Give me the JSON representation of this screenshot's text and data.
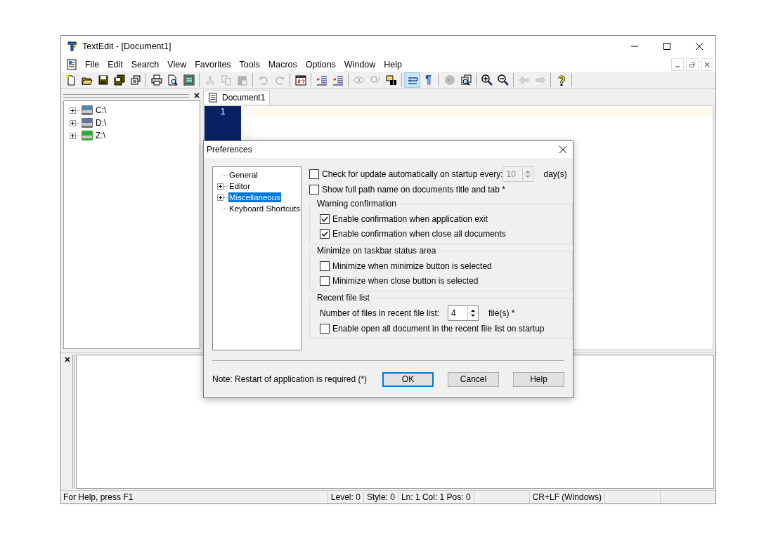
{
  "window": {
    "title": "TextEdit - [Document1]"
  },
  "menu": [
    "File",
    "Edit",
    "Search",
    "View",
    "Favorites",
    "Tools",
    "Macros",
    "Options",
    "Window",
    "Help"
  ],
  "toolbar": [
    [
      {
        "disabled": false,
        "pressed": false
      },
      {
        "disabled": false,
        "pressed": false
      },
      {
        "disabled": false,
        "pressed": false
      },
      {
        "disabled": false,
        "pressed": false
      },
      {
        "disabled": false,
        "pressed": false
      }
    ],
    [
      {
        "disabled": false,
        "pressed": false
      },
      {
        "disabled": false,
        "pressed": false
      },
      {
        "disabled": false,
        "pressed": false
      }
    ],
    [
      {
        "disabled": true,
        "pressed": false
      },
      {
        "disabled": true,
        "pressed": false
      },
      {
        "disabled": true,
        "pressed": false
      }
    ],
    [
      {
        "disabled": true,
        "pressed": false
      },
      {
        "disabled": true,
        "pressed": false
      }
    ],
    [
      {
        "disabled": false,
        "pressed": false
      }
    ],
    [
      {
        "disabled": false,
        "pressed": false
      },
      {
        "disabled": false,
        "pressed": false
      }
    ],
    [
      {
        "disabled": true,
        "pressed": false
      },
      {
        "disabled": true,
        "pressed": false
      },
      {
        "disabled": false,
        "pressed": false
      }
    ],
    [
      {
        "disabled": false,
        "pressed": true
      },
      {
        "disabled": false,
        "pressed": false,
        "label": "¶"
      }
    ],
    [
      {
        "disabled": true,
        "pressed": false
      },
      {
        "disabled": false,
        "pressed": false
      }
    ],
    [
      {
        "disabled": false,
        "pressed": false
      },
      {
        "disabled": false,
        "pressed": false
      }
    ],
    [
      {
        "disabled": true,
        "pressed": false
      },
      {
        "disabled": true,
        "pressed": false
      }
    ],
    [
      {
        "disabled": false,
        "pressed": false
      }
    ]
  ],
  "file_tree": [
    {
      "label": "C:\\",
      "expanded": false
    },
    {
      "label": "D:\\",
      "expanded": false
    },
    {
      "label": "Z:\\",
      "expanded": false
    }
  ],
  "editor": {
    "tabs": [
      {
        "label": "Document1",
        "selected": true
      }
    ],
    "line_numbers": [
      "1"
    ]
  },
  "dialog": {
    "title": "Preferences",
    "tree": [
      {
        "label": "General",
        "kind": "leaf",
        "selected": false
      },
      {
        "label": "Editor",
        "kind": "branch",
        "expanded": false,
        "selected": false
      },
      {
        "label": "Miscellaneous",
        "kind": "branch",
        "expanded": false,
        "selected": true
      },
      {
        "label": "Keyboard Shortcuts",
        "kind": "leaf",
        "selected": false
      }
    ],
    "options": [
      {
        "kind": "check_spin",
        "label": "Check for update automatically on startup every:",
        "checked": false,
        "value": "10",
        "disabled": true,
        "unit": "day(s)"
      },
      {
        "kind": "check",
        "label": "Show full path name on documents title and tab *",
        "checked": false
      }
    ],
    "groups": [
      {
        "title": "Warning confirmation",
        "items": [
          {
            "kind": "check",
            "label": "Enable confirmation when application exit",
            "checked": true
          },
          {
            "kind": "check",
            "label": "Enable confirmation when close all documents",
            "checked": true
          }
        ]
      },
      {
        "title": "Minimize on taskbar status area",
        "items": [
          {
            "kind": "check",
            "label": "Minimize when minimize button is selected",
            "checked": false
          },
          {
            "kind": "check",
            "label": "Minimize when close button is selected",
            "checked": false
          }
        ]
      },
      {
        "title": "Recent file list",
        "items": [
          {
            "kind": "spin",
            "label": "Number of files in recent file list:",
            "value": "4",
            "disabled": false,
            "unit": "file(s) *"
          },
          {
            "kind": "check",
            "label": "Enable open all document in the recent file list on startup",
            "checked": false
          }
        ]
      }
    ],
    "note": "Note: Restart of application is required (*)",
    "buttons": [
      {
        "label": "OK",
        "default": true
      },
      {
        "label": "Cancel",
        "default": false
      },
      {
        "label": "Help",
        "default": false
      }
    ]
  },
  "status_bar": {
    "message": "For Help, press F1",
    "panels": [
      "Level: 0",
      "Style: 0",
      "Ln: 1 Col: 1 Pos: 0",
      "CR+LF (Windows)"
    ]
  }
}
